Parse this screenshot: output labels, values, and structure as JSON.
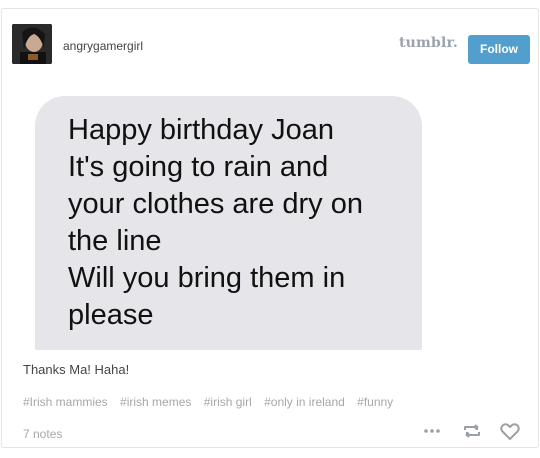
{
  "post": {
    "username": "angrygamergirl",
    "brand": "tumblr.",
    "follow_label": "Follow",
    "message_lines": [
      "Happy birthday Joan",
      "It's going to rain and",
      "your clothes are dry on",
      "the line",
      "Will you bring them in",
      "please"
    ],
    "caption": "Thanks Ma! Haha!",
    "tags": [
      "#Irish mammies",
      "#irish memes",
      "#irish girl",
      "#only in ireland",
      "#funny"
    ],
    "notes": "7 notes"
  },
  "colors": {
    "follow_button": "#529ecc",
    "bubble": "#e5e5ea",
    "tag_text": "#a7a7a7"
  },
  "icons": [
    "more-icon",
    "reblog-icon",
    "like-icon"
  ]
}
